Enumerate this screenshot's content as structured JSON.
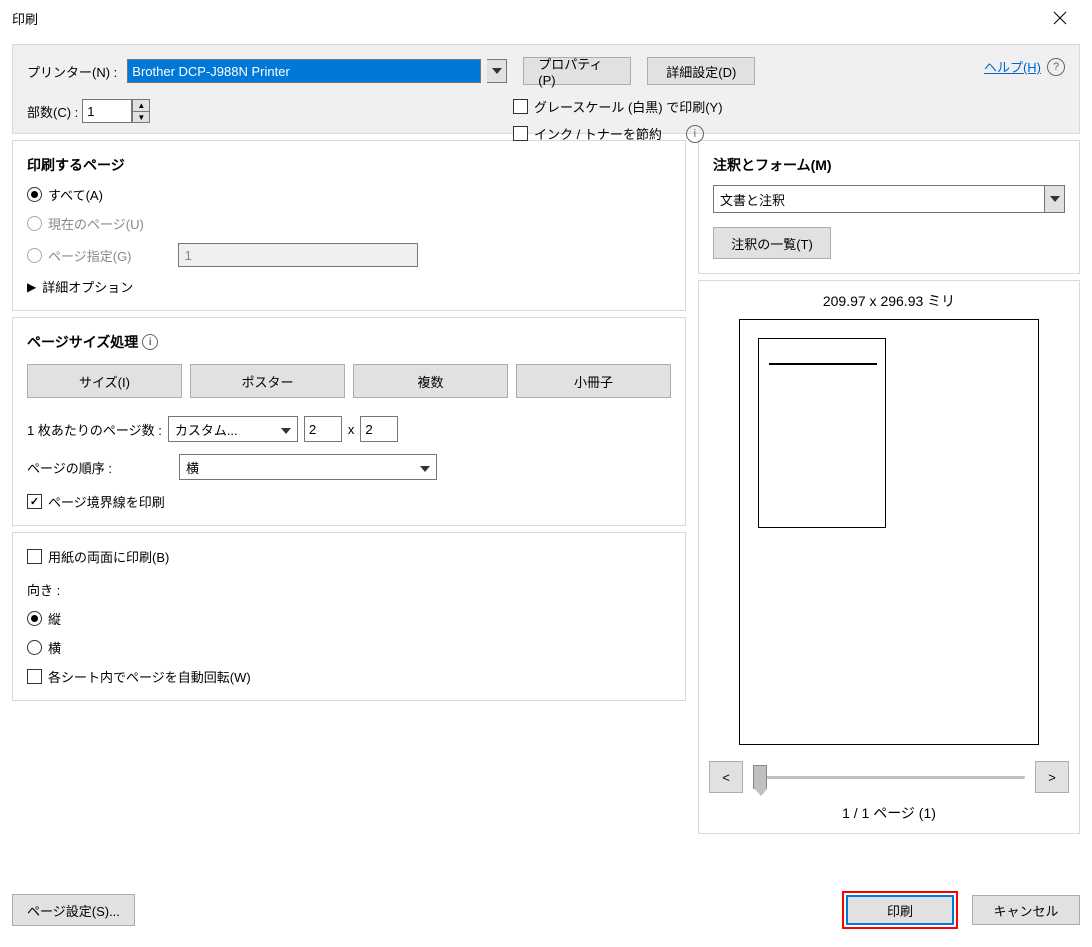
{
  "titlebar": {
    "title": "印刷"
  },
  "top": {
    "printer_label": "プリンター(N) :",
    "printer_name": "Brother DCP-J988N Printer",
    "properties_btn": "プロパティ(P)",
    "advanced_btn": "詳細設定(D)",
    "help_link": "ヘルプ(H)",
    "copies_label": "部数(C) :",
    "copies_value": "1",
    "grayscale_label": "グレースケール (白黒) で印刷(Y)",
    "save_ink_label": "インク / トナーを節約"
  },
  "pages": {
    "title": "印刷するページ",
    "all": "すべて(A)",
    "current": "現在のページ(U)",
    "range": "ページ指定(G)",
    "range_value": "1",
    "more_options": "詳細オプション"
  },
  "sizing": {
    "title": "ページサイズ処理",
    "tabs": {
      "size": "サイズ(I)",
      "poster": "ポスター",
      "multiple": "複数",
      "booklet": "小冊子"
    },
    "pps_label": "1 枚あたりのページ数 :",
    "pps_value": "カスタム...",
    "pps_w": "2",
    "pps_x": "x",
    "pps_h": "2",
    "order_label": "ページの順序 :",
    "order_value": "横",
    "borders_label": "ページ境界線を印刷"
  },
  "duplex": {
    "label": "用紙の両面に印刷(B)"
  },
  "orientation": {
    "title": "向き :",
    "portrait": "縦",
    "landscape": "横",
    "autorotate": "各シート内でページを自動回転(W)"
  },
  "annotations": {
    "title": "注釈とフォーム(M)",
    "selected": "文書と注釈",
    "list_btn": "注釈の一覧(T)"
  },
  "preview": {
    "dims": "209.97 x 296.93 ミリ",
    "prev": "<",
    "next": ">",
    "counter": "1 / 1 ページ (1)"
  },
  "footer": {
    "page_setup": "ページ設定(S)...",
    "print": "印刷",
    "cancel": "キャンセル"
  }
}
